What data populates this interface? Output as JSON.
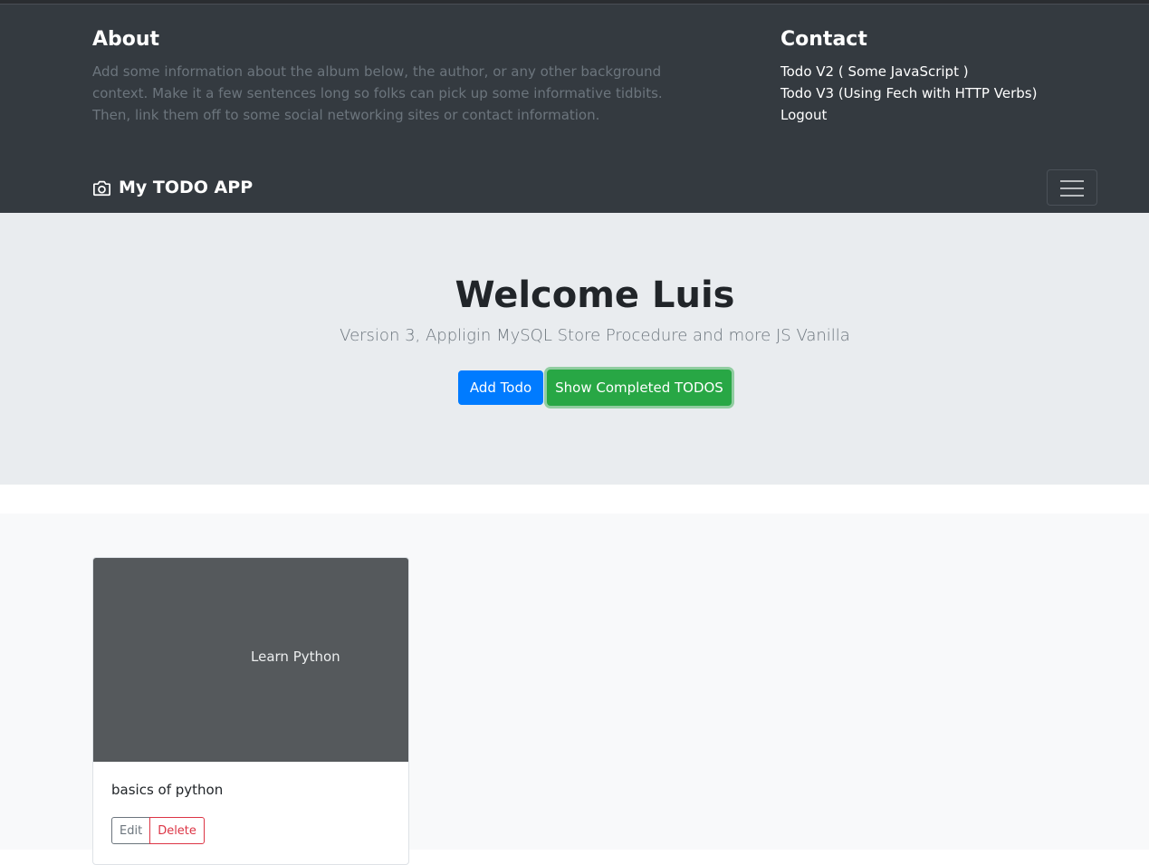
{
  "about": {
    "title": "About",
    "text": "Add some information about the album below, the author, or any other background context. Make it a few sentences long so folks can pick up some informative tidbits. Then, link them off to some social networking sites or contact information."
  },
  "contact": {
    "title": "Contact",
    "links": [
      "Todo V2 ( Some JavaScript )",
      "Todo V3 (Using Fech with HTTP Verbs)",
      "Logout"
    ]
  },
  "navbar": {
    "brand": "My TODO APP",
    "brand_icon": "camera-icon",
    "toggler_icon": "hamburger-menu-icon"
  },
  "hero": {
    "title": "Welcome Luis",
    "subtitle": "Version 3, Appligin MySQL Store Procedure and more JS Vanilla",
    "add_button": "Add Todo",
    "completed_button": "Show Completed TODOS"
  },
  "todos": [
    {
      "thumbnail_text": "Learn Python",
      "description": "basics of python",
      "edit_label": "Edit",
      "delete_label": "Delete"
    }
  ],
  "colors": {
    "header_bg": "#343a40",
    "jumbotron_bg": "#e9ecef",
    "primary": "#007bff",
    "success": "#28a745",
    "danger": "#dc3545",
    "muted": "#6c757d"
  }
}
